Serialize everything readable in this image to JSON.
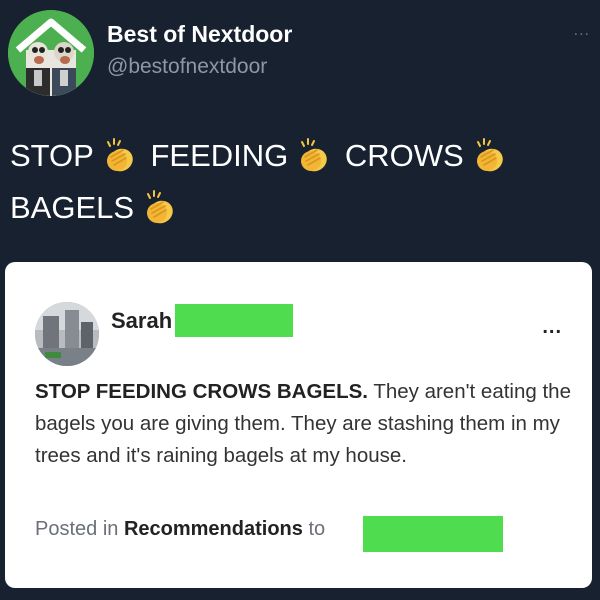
{
  "account": {
    "display_name": "Best of Nextdoor",
    "handle": "@bestofnextdoor",
    "more_label": "..."
  },
  "tweet": {
    "words": [
      "STOP",
      "FEEDING",
      "CROWS",
      "BAGELS"
    ],
    "emoji": "clapping-hands"
  },
  "card": {
    "author_name": "Sarah",
    "more_label": "...",
    "lead_text": "STOP FEEDING CROWS BAGELS.",
    "body_text": "They aren't eating the bagels you are giving them. They are stashing them in my trees and it's raining bagels at my house.",
    "posted_prefix": "Posted in",
    "category": "Recommendations",
    "posted_to": "to"
  },
  "colors": {
    "background": "#172130",
    "redaction": "#4fdc4f",
    "avatar_bg": "#4caf50"
  }
}
